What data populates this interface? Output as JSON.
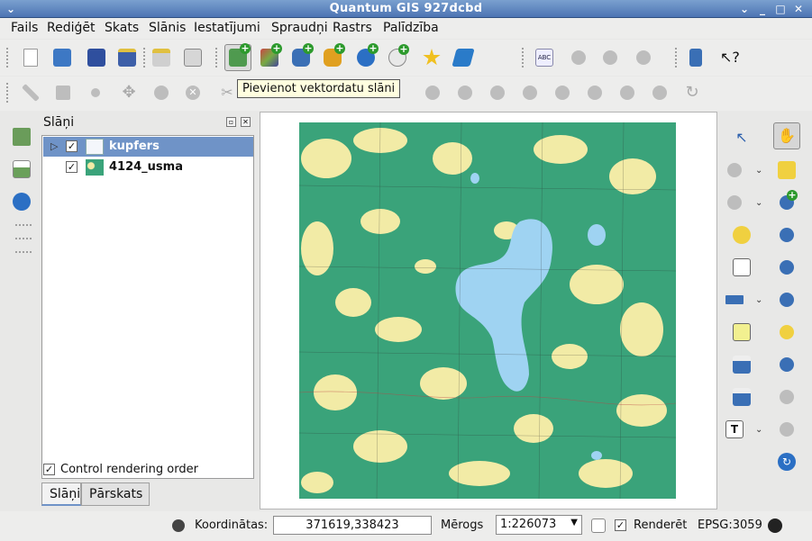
{
  "window": {
    "title": "Quantum GIS 927dcbd"
  },
  "menu": [
    "Fails",
    "Rediģēt",
    "Skats",
    "Slānis",
    "Iestatījumi",
    "Spraudņi",
    "Rastrs",
    "Palīdzība"
  ],
  "tooltip": "Pievienot vektordatu slāni",
  "layers_panel": {
    "title": "Slāņi",
    "layers": [
      {
        "name": "kupfers",
        "checked": true,
        "selected": true
      },
      {
        "name": "4124_usma",
        "checked": true,
        "selected": false
      }
    ],
    "control_rendering_order_label": "Control rendering order",
    "tabs": [
      "Slāņi",
      "Pārskats"
    ]
  },
  "statusbar": {
    "coords_label": "Koordinātas:",
    "coords_value": "371619,338423",
    "scale_label": "Mērogs",
    "scale_value": "1:226073",
    "render_label": "Renderēt",
    "crs": "EPSG:3059"
  },
  "colors": {
    "accent": "#6f93c7",
    "forest": "#3aa37a",
    "open_land": "#f2eba6",
    "water": "#9fd3f2"
  }
}
